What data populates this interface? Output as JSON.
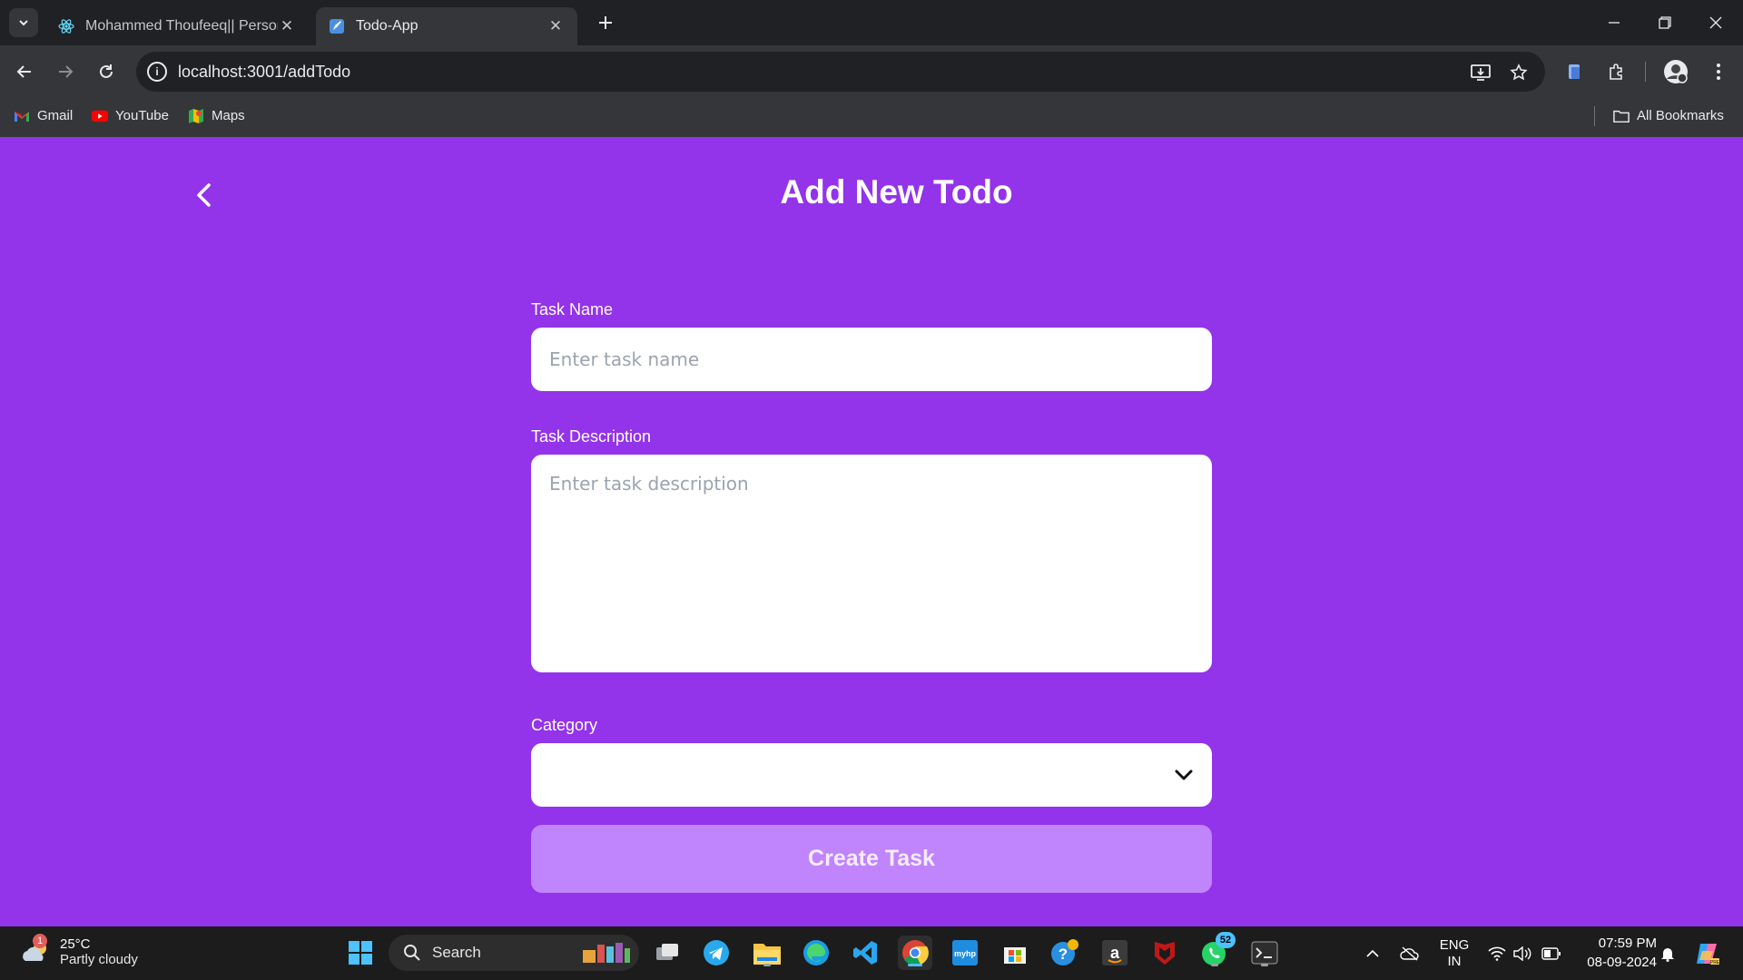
{
  "browser": {
    "tabs": [
      {
        "title": "Mohammed Thoufeeq|| Personal",
        "active": false
      },
      {
        "title": "Todo-App",
        "active": true
      }
    ],
    "url": "localhost:3001/addTodo",
    "bookmarks": [
      {
        "label": "Gmail",
        "icon": "gmail-icon"
      },
      {
        "label": "YouTube",
        "icon": "youtube-icon"
      },
      {
        "label": "Maps",
        "icon": "maps-icon"
      }
    ],
    "all_bookmarks": "All Bookmarks"
  },
  "page": {
    "title": "Add New Todo",
    "task_name_label": "Task Name",
    "task_name_placeholder": "Enter task name",
    "task_desc_label": "Task Description",
    "task_desc_placeholder": "Enter task description",
    "category_label": "Category",
    "category_value": "",
    "create_button": "Create Task",
    "colors": {
      "background": "#9333ea",
      "button": "#c084fc"
    }
  },
  "taskbar": {
    "weather": {
      "temp": "25°C",
      "condition": "Partly cloudy",
      "badge": "1"
    },
    "search_label": "Search",
    "whatsapp_badge": "52",
    "language": {
      "line1": "ENG",
      "line2": "IN"
    },
    "time": "07:59 PM",
    "date": "08-09-2024"
  }
}
